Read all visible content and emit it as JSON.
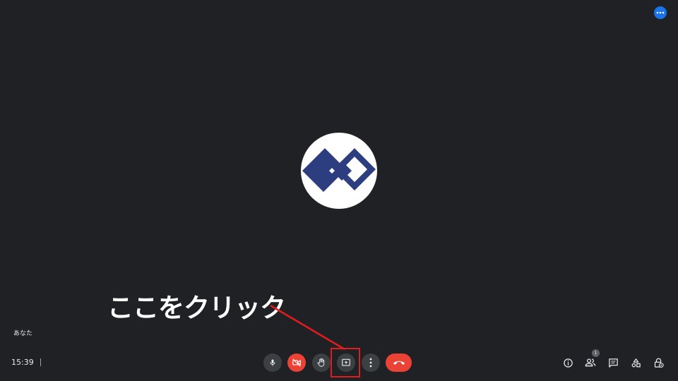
{
  "top_bar": {
    "more_icon": "more-horiz-icon",
    "more_color": "#1a73e8"
  },
  "participant": {
    "name": "あなた",
    "avatar_icon": "company-logo",
    "logo_color": "#2c3e80"
  },
  "annotation": {
    "text": "ここをクリック",
    "color": "#e01c1c"
  },
  "footer": {
    "time": "15:39",
    "controls": [
      {
        "name": "mic",
        "icon": "mic-icon"
      },
      {
        "name": "camera-off",
        "icon": "videocam-off-icon",
        "color": "#ea4335"
      },
      {
        "name": "raise-hand",
        "icon": "hand-icon"
      },
      {
        "name": "present-screen",
        "icon": "present-to-all-icon"
      },
      {
        "name": "more-options",
        "icon": "more-vert-icon"
      },
      {
        "name": "leave-call",
        "icon": "call-end-icon",
        "color": "#ea4335"
      }
    ],
    "right": {
      "people_count": "1",
      "icons": [
        "info-icon",
        "people-icon",
        "chat-icon",
        "activities-icon",
        "host-controls-icon"
      ]
    }
  }
}
